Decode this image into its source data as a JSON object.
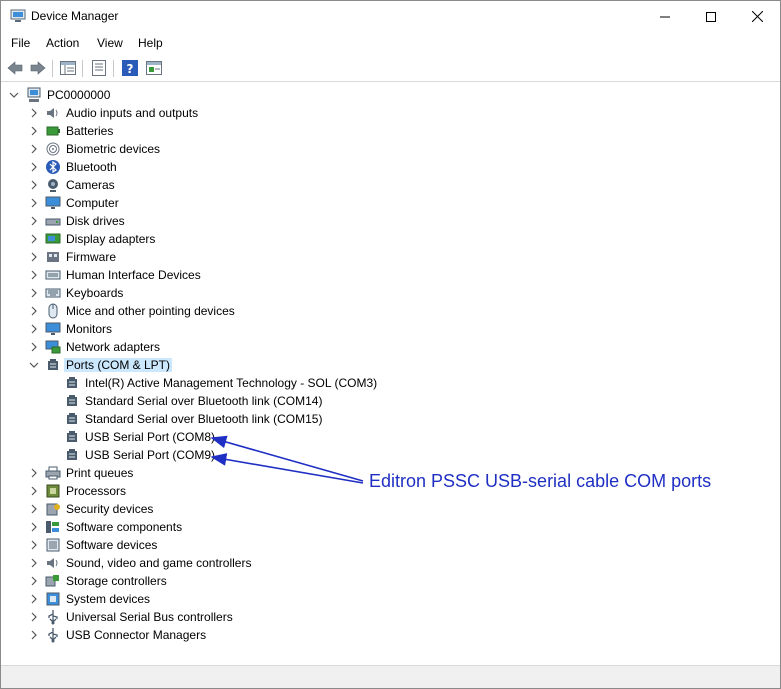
{
  "window": {
    "title": "Device Manager",
    "minimize_glyph": "—",
    "close_glyph": "✕"
  },
  "menu": [
    "File",
    "Action",
    "View",
    "Help"
  ],
  "toolbar": {
    "buttons": [
      "back-arrow-icon",
      "forward-arrow-icon",
      "show-hide-tree-icon",
      "properties-icon",
      "help-icon",
      "scan-hardware-icon"
    ]
  },
  "tree": {
    "root": "PC0000000",
    "categories": [
      {
        "label": "Audio inputs and outputs",
        "icon": "speaker-icon"
      },
      {
        "label": "Batteries",
        "icon": "battery-icon"
      },
      {
        "label": "Biometric devices",
        "icon": "fingerprint-icon"
      },
      {
        "label": "Bluetooth",
        "icon": "bluetooth-icon"
      },
      {
        "label": "Cameras",
        "icon": "camera-icon"
      },
      {
        "label": "Computer",
        "icon": "monitor-icon"
      },
      {
        "label": "Disk drives",
        "icon": "disk-drive-icon"
      },
      {
        "label": "Display adapters",
        "icon": "display-adapter-icon"
      },
      {
        "label": "Firmware",
        "icon": "chip-board-icon"
      },
      {
        "label": "Human Interface Devices",
        "icon": "hid-icon"
      },
      {
        "label": "Keyboards",
        "icon": "keyboard-icon"
      },
      {
        "label": "Mice and other pointing devices",
        "icon": "mouse-icon"
      },
      {
        "label": "Monitors",
        "icon": "monitor-icon"
      },
      {
        "label": "Network adapters",
        "icon": "network-adapter-icon"
      },
      {
        "label": "Ports (COM & LPT)",
        "icon": "port-icon",
        "expanded": true,
        "children": [
          "Intel(R) Active Management Technology - SOL (COM3)",
          "Standard Serial over Bluetooth link (COM14)",
          "Standard Serial over Bluetooth link (COM15)",
          "USB Serial Port (COM8)",
          "USB Serial Port (COM9)"
        ]
      },
      {
        "label": "Print queues",
        "icon": "printer-icon"
      },
      {
        "label": "Processors",
        "icon": "processor-icon"
      },
      {
        "label": "Security devices",
        "icon": "security-device-icon"
      },
      {
        "label": "Software components",
        "icon": "software-component-icon"
      },
      {
        "label": "Software devices",
        "icon": "software-device-icon"
      },
      {
        "label": "Sound, video and game controllers",
        "icon": "speaker-icon"
      },
      {
        "label": "Storage controllers",
        "icon": "storage-controller-icon"
      },
      {
        "label": "System devices",
        "icon": "system-device-icon"
      },
      {
        "label": "Universal Serial Bus controllers",
        "icon": "usb-icon"
      },
      {
        "label": "USB Connector Managers",
        "icon": "usb-icon"
      }
    ]
  },
  "annotation": {
    "text": "Editron PSSC USB-serial cable COM ports",
    "color": "#1f2fc4"
  },
  "colors": {
    "selection": "#cce8ff",
    "annotation": "#1f2fc4"
  }
}
